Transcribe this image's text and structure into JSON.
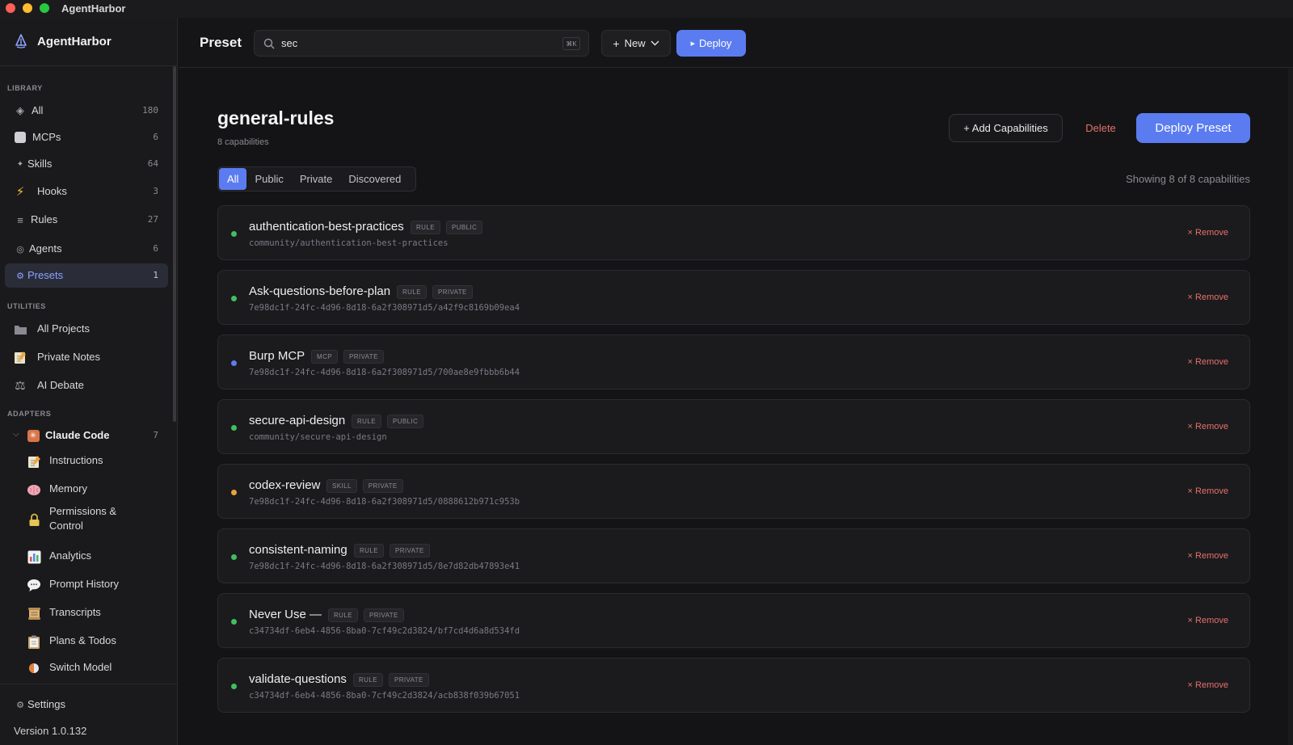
{
  "window": {
    "title": "AgentHarbor"
  },
  "sidebar": {
    "brand": "AgentHarbor",
    "library_label": "LIBRARY",
    "library": [
      {
        "label": "All",
        "count": "180",
        "icon": "diamond-icon"
      },
      {
        "label": "MCPs",
        "count": "6",
        "icon": "mcp-icon"
      },
      {
        "label": "Skills",
        "count": "64",
        "icon": "sparkle-icon"
      },
      {
        "label": "Hooks",
        "count": "3",
        "icon": "lightning-icon"
      },
      {
        "label": "Rules",
        "count": "27",
        "icon": "list-icon"
      },
      {
        "label": "Agents",
        "count": "6",
        "icon": "agent-icon"
      },
      {
        "label": "Presets",
        "count": "1",
        "icon": "gear-icon",
        "active": true
      }
    ],
    "utilities_label": "UTILITIES",
    "utilities": [
      {
        "label": "All Projects",
        "icon": "folder-icon"
      },
      {
        "label": "Private Notes",
        "icon": "notepad-icon"
      },
      {
        "label": "AI Debate",
        "icon": "scales-icon"
      }
    ],
    "adapters_label": "ADAPTERS",
    "adapter": {
      "label": "Claude Code",
      "count": "7",
      "icon": "claude-icon"
    },
    "adapter_items": [
      {
        "label": "Instructions",
        "icon": "memo-icon"
      },
      {
        "label": "Memory",
        "icon": "brain-icon"
      },
      {
        "label": "Permissions &",
        "label2": "Control",
        "icon": "lock-icon"
      },
      {
        "label": "Analytics",
        "icon": "bar-chart-icon"
      },
      {
        "label": "Prompt History",
        "icon": "speech-bubble-icon"
      },
      {
        "label": "Transcripts",
        "icon": "scroll-icon"
      },
      {
        "label": "Plans & Todos",
        "icon": "clipboard-icon"
      },
      {
        "label": "Switch Model",
        "icon": "switch-icon"
      }
    ],
    "settings": "Settings",
    "version": "Version 1.0.132"
  },
  "header": {
    "title": "Preset",
    "search_value": "sec",
    "search_shortcut": "⌘K",
    "new_label": "New",
    "deploy_label": "Deploy"
  },
  "preset": {
    "name": "general-rules",
    "subtitle": "8 capabilities",
    "add_label": "+ Add Capabilities",
    "delete_label": "Delete",
    "deploy_label": "Deploy Preset",
    "tabs": [
      "All",
      "Public",
      "Private",
      "Discovered"
    ],
    "active_tab": "All",
    "showing": "Showing 8 of 8 capabilities",
    "remove_label": "× Remove"
  },
  "capabilities": [
    {
      "name": "authentication-best-practices",
      "type": "RULE",
      "visibility": "PUBLIC",
      "path": "community/authentication-best-practices",
      "status_color": "#3fbf5f"
    },
    {
      "name": "Ask-questions-before-plan",
      "type": "RULE",
      "visibility": "PRIVATE",
      "path": "7e98dc1f-24fc-4d96-8d18-6a2f308971d5/a42f9c8169b09ea4",
      "status_color": "#3fbf5f"
    },
    {
      "name": "Burp MCP",
      "type": "MCP",
      "visibility": "PRIVATE",
      "path": "7e98dc1f-24fc-4d96-8d18-6a2f308971d5/700ae8e9fbbb6b44",
      "status_color": "#5b7cf0"
    },
    {
      "name": "secure-api-design",
      "type": "RULE",
      "visibility": "PUBLIC",
      "path": "community/secure-api-design",
      "status_color": "#3fbf5f"
    },
    {
      "name": "codex-review",
      "type": "SKILL",
      "visibility": "PRIVATE",
      "path": "7e98dc1f-24fc-4d96-8d18-6a2f308971d5/0888612b971c953b",
      "status_color": "#e8a33a"
    },
    {
      "name": "consistent-naming",
      "type": "RULE",
      "visibility": "PRIVATE",
      "path": "7e98dc1f-24fc-4d96-8d18-6a2f308971d5/8e7d82db47893e41",
      "status_color": "#3fbf5f"
    },
    {
      "name": "Never Use —",
      "type": "RULE",
      "visibility": "PRIVATE",
      "path": "c34734df-6eb4-4856-8ba0-7cf49c2d3824/bf7cd4d6a8d534fd",
      "status_color": "#3fbf5f"
    },
    {
      "name": "validate-questions",
      "type": "RULE",
      "visibility": "PRIVATE",
      "path": "c34734df-6eb4-4856-8ba0-7cf49c2d3824/acb838f039b67051",
      "status_color": "#3fbf5f"
    }
  ],
  "colors": {
    "accent": "#5b7cf0",
    "danger": "#e5706a",
    "bg": "#141416",
    "sidebar": "#1a1a1c"
  }
}
